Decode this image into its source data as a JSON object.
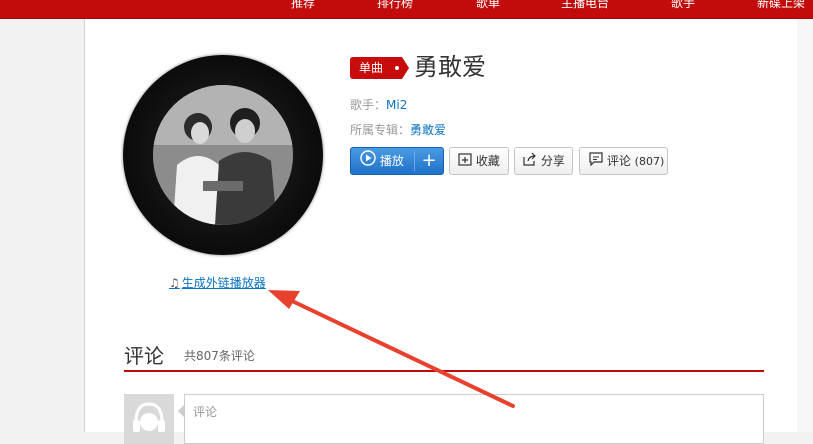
{
  "nav": {
    "items": [
      "推荐",
      "排行榜",
      "歌单",
      "主播电台",
      "歌手",
      "新碟上架"
    ]
  },
  "song": {
    "badge": "单曲",
    "title": "勇敢爱",
    "singer_label": "歌手：",
    "singer": "Mi2",
    "album_label": "所属专辑：",
    "album": "勇敢爱"
  },
  "actions": {
    "play": "播放",
    "add": "+",
    "collect": "收藏",
    "share": "分享",
    "comment": "评论",
    "comment_count": "(807)"
  },
  "ext_link": "生成外链播放器",
  "comments": {
    "heading": "评论",
    "count_text": "共807条评论",
    "placeholder": "评论"
  },
  "colors": {
    "brand_red": "#c20c0c",
    "link_blue": "#0c73c2",
    "annotation_arrow": "#e8412e"
  },
  "icons": [
    "play-icon",
    "plus-icon",
    "collect-icon",
    "share-icon",
    "comment-icon",
    "music-note-icon",
    "avatar-icon"
  ]
}
